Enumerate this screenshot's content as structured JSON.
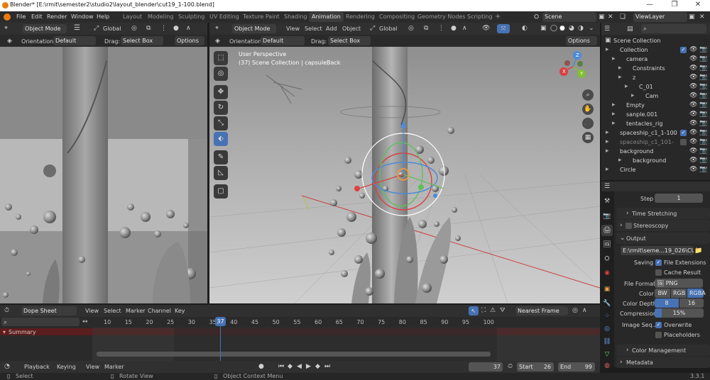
{
  "window": {
    "title": "Blender* [E:\\rmit\\semester2\\studio2\\layout_blender\\cut19_1-100.blend]",
    "minimize": "—",
    "maximize": "❐",
    "close": "✕"
  },
  "menu": {
    "items": [
      "File",
      "Edit",
      "Render",
      "Window",
      "Help"
    ],
    "workspaces": [
      "Layout",
      "Modeling",
      "Sculpting",
      "UV Editing",
      "Texture Paint",
      "Shading",
      "Animation",
      "Rendering",
      "Compositing",
      "Geometry Nodes",
      "Scripting"
    ],
    "active_workspace": "Animation",
    "add_tab": "+",
    "scene_name": "Scene",
    "view_layer": "ViewLayer"
  },
  "left_viewport": {
    "mode": "Object Mode",
    "view_menu_icon": "hamburger-icon",
    "transform": "Global",
    "orientation_label": "Orientation:",
    "orientation_value": "Default",
    "drag_label": "Drag:",
    "drag_value": "Select Box",
    "options": "Options"
  },
  "main_viewport": {
    "mode": "Object Mode",
    "menus": [
      "View",
      "Select",
      "Add",
      "Object"
    ],
    "transform": "Global",
    "orientation_label": "Orientation:",
    "orientation_value": "Default",
    "drag_label": "Drag:",
    "drag_value": "Select Box",
    "options": "Options",
    "perspective": "User Perspective",
    "info": "(37) Scene Collection | capsuleBack",
    "gizmo_axes": [
      "X",
      "Y",
      "Z"
    ]
  },
  "outliner": {
    "root": "Scene Collection",
    "rows": [
      {
        "name": "Collection",
        "indent": 1,
        "icon": "▣",
        "color": "#dddddd",
        "checked": true
      },
      {
        "name": "camera",
        "indent": 2,
        "icon": "⅄",
        "color": "#e8a04c"
      },
      {
        "name": "Constraints",
        "indent": 3,
        "icon": "⛓",
        "color": "#a0b4e0"
      },
      {
        "name": "z",
        "indent": 3,
        "icon": "⅄",
        "color": "#e8a04c"
      },
      {
        "name": "C_01",
        "indent": 4,
        "icon": "🎥",
        "color": "#e8a04c"
      },
      {
        "name": "Cam",
        "indent": 5,
        "icon": "▱",
        "color": "#6fcfb0"
      },
      {
        "name": "Empty",
        "indent": 2,
        "icon": "⅄",
        "color": "#e8a04c"
      },
      {
        "name": "sanple.001",
        "indent": 2,
        "icon": "▽",
        "color": "#e8a04c"
      },
      {
        "name": "tentacles_rig",
        "indent": 2,
        "icon": "⅄",
        "color": "#e8a04c"
      },
      {
        "name": "spaceship_c1_1-100",
        "indent": 1,
        "icon": "▣",
        "color": "#dddddd",
        "checked": true
      },
      {
        "name": "spaceship_c1_101-",
        "indent": 1,
        "icon": "▣",
        "color": "#888888",
        "checked": false
      },
      {
        "name": "background",
        "indent": 1,
        "icon": "▣",
        "color": "#e8a04c"
      },
      {
        "name": "background",
        "indent": 3,
        "icon": "🔗",
        "color": "#dddddd"
      },
      {
        "name": "Circle",
        "indent": 1,
        "icon": "▽",
        "color": "#e8a04c"
      }
    ]
  },
  "properties": {
    "step_label": "Step",
    "step_value": "1",
    "time_stretching": "Time Stretching",
    "stereoscopy": "Stereoscopy",
    "output_header": "Output",
    "output_path": "E:\\rmit\\seme...19_026\\CUT19",
    "saving_label": "Saving",
    "file_extensions": "File Extensions",
    "cache_result": "Cache Result",
    "file_format_label": "File Format",
    "file_format_value": "PNG",
    "color_label": "Color",
    "color_options": [
      "BW",
      "RGB",
      "RGBA"
    ],
    "color_active": "RGBA",
    "color_depth_label": "Color Depth",
    "color_depth_options": [
      "8",
      "16"
    ],
    "color_depth_active": "8",
    "compression_label": "Compression",
    "compression_value": "15%",
    "compression_fraction": 0.15,
    "image_seq_label": "Image Seq...",
    "overwrite": "Overwrite",
    "placeholders": "Placeholders",
    "color_management": "Color Management",
    "metadata": "Metadata"
  },
  "dopesheet": {
    "editor": "Dope Sheet",
    "menus": [
      "View",
      "Select",
      "Marker",
      "Channel",
      "Key"
    ],
    "interpolation": "Nearest Frame",
    "summary": "Summary",
    "ticks": [
      "10",
      "15",
      "20",
      "25",
      "30",
      "35",
      "37",
      "40",
      "45",
      "50",
      "55",
      "60",
      "65",
      "70",
      "75",
      "80",
      "85",
      "90",
      "95",
      "100"
    ],
    "current_frame": "37"
  },
  "timeline": {
    "menus": [
      "Playback",
      "Keying",
      "View",
      "Marker"
    ],
    "current_frame": "37",
    "start_label": "Start",
    "start": "26",
    "end_label": "End",
    "end": "99"
  },
  "statusbar": {
    "select": "Select",
    "rotate": "Rotate View",
    "context": "Object Context Menu",
    "version": "3.3.1"
  },
  "colors": {
    "accent": "#4772b3",
    "active_frame": "#4772b3",
    "summary_row": "#5a1e1e"
  }
}
